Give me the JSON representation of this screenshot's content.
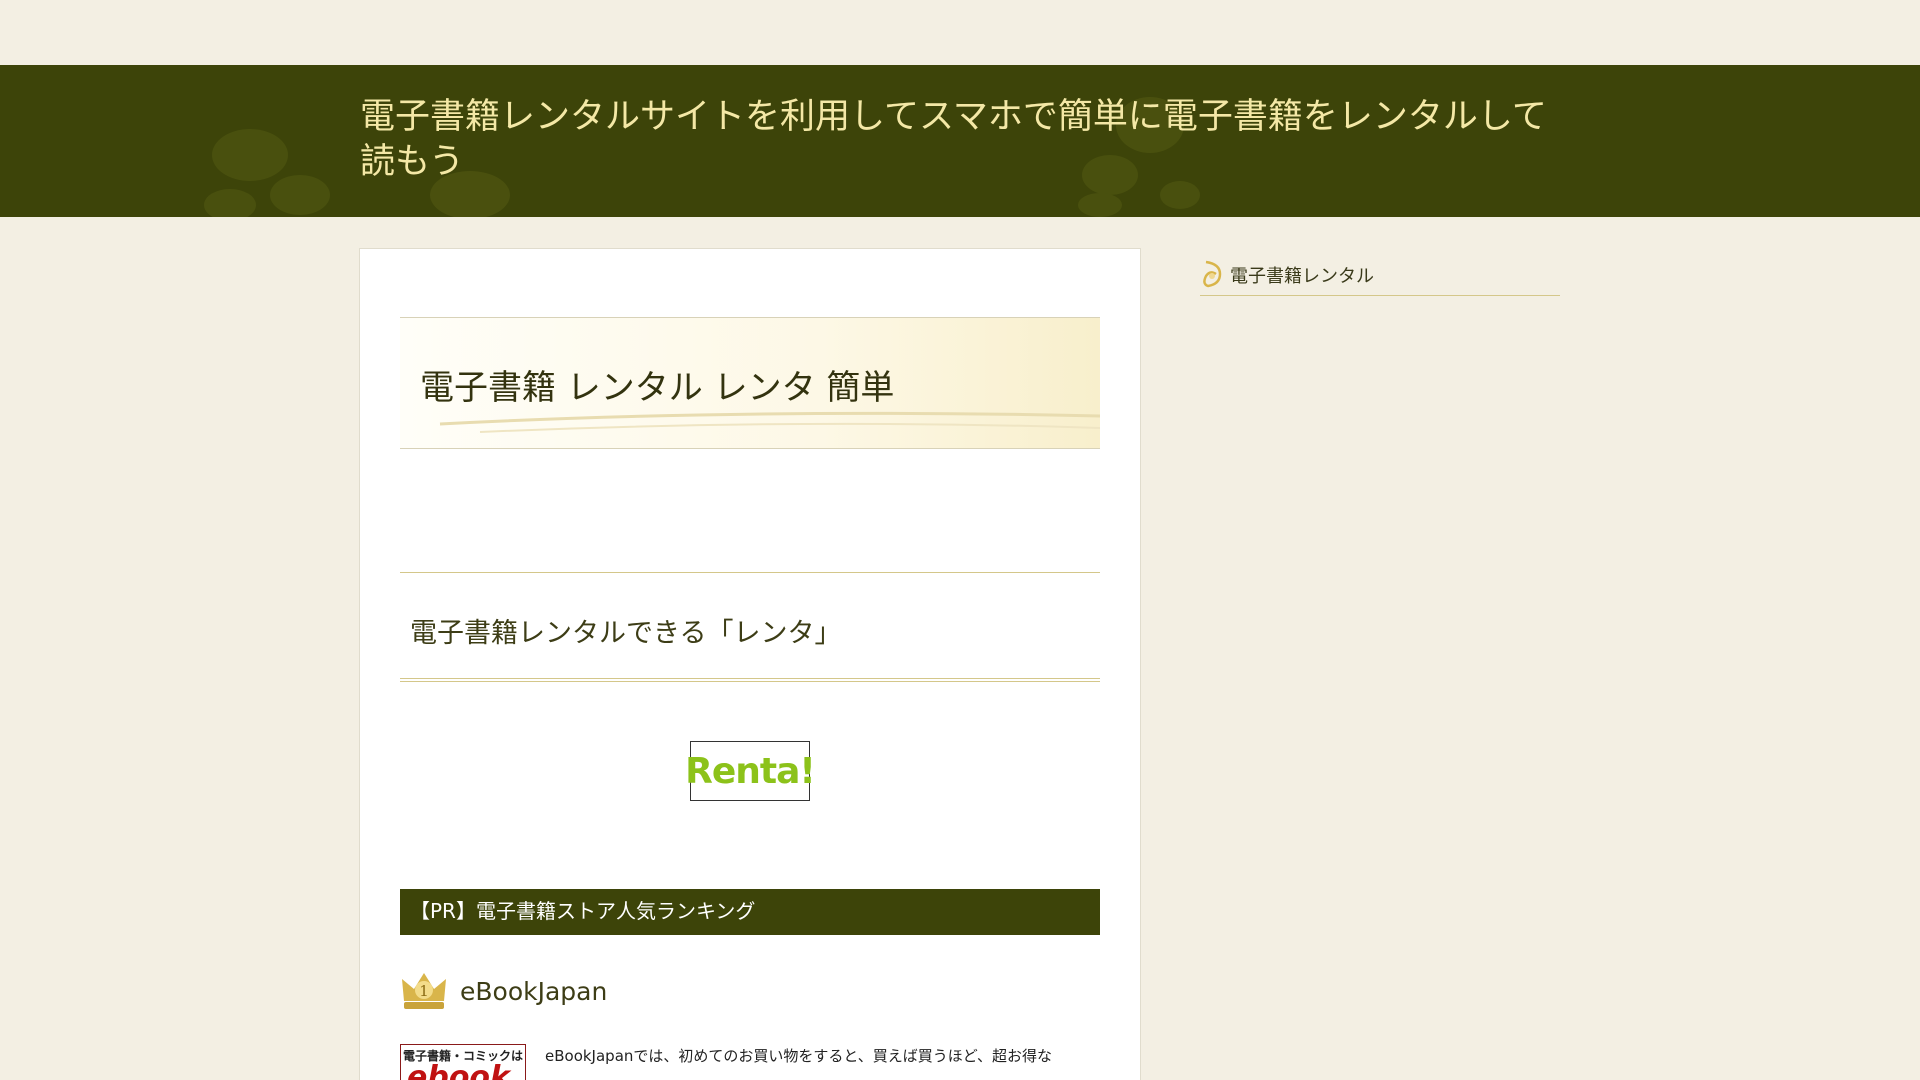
{
  "header": {
    "site_title": "電子書籍レンタルサイトを利用してスマホで簡単に電子書籍をレンタルして読もう"
  },
  "entry": {
    "title": "電子書籍 レンタル レンタ 簡単"
  },
  "section": {
    "heading": "電子書籍レンタルできる「レンタ」"
  },
  "renta_logo": {
    "text": "Renta!"
  },
  "ranking": {
    "bar_label": "【PR】電子書籍ストア人気ランキング",
    "items": [
      {
        "rank": "1",
        "name": "eBookJapan",
        "thumb_line1": "電子書籍・コミックは",
        "thumb_line2": "ebook",
        "description": "eBookJapanでは、初めてのお買い物をすると、買えば買うほど、超お得な"
      }
    ]
  },
  "sidebar": {
    "items": [
      {
        "label": "電子書籍レンタル"
      }
    ]
  },
  "colors": {
    "header_bg": "#3d4409",
    "title_text": "#f4e8a6",
    "accent_gold": "#d4c78a",
    "renta_green": "#8cc21a",
    "ebook_red": "#c01212"
  }
}
